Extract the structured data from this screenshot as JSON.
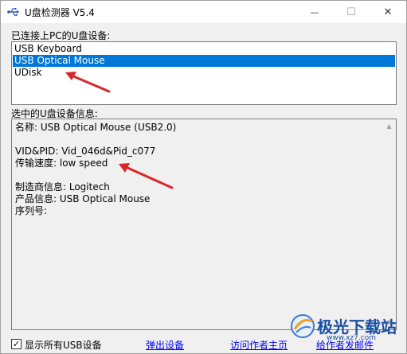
{
  "window": {
    "title": "U盘检测器 V5.4",
    "minimize_glyph": "—",
    "maximize_glyph": "☐",
    "close_glyph": "✕"
  },
  "devices": {
    "label": "已连接上PC的U盘设备:",
    "items": [
      {
        "label": "USB Keyboard",
        "selected": false
      },
      {
        "label": "USB Optical Mouse",
        "selected": true
      },
      {
        "label": "UDisk",
        "selected": false
      }
    ]
  },
  "info": {
    "label": "选中的U盘设备信息:",
    "name_line": "名称: USB Optical Mouse  (USB2.0)",
    "vidpid_line": "VID&PID: Vid_046d&Pid_c077",
    "speed_line": "传输速度: low speed",
    "vendor_line": "制造商信息: Logitech",
    "product_line": "产品信息: USB Optical Mouse",
    "serial_line": "序列号:"
  },
  "footer": {
    "show_all_checked": true,
    "show_all_label": "显示所有USB设备",
    "eject_link": "弹出设备",
    "visit_author_link": "访问作者主页",
    "email_author_link": "给作者发邮件"
  },
  "watermark": {
    "brand": "极光下载站",
    "url": "www.xz7.com"
  },
  "colors": {
    "selection": "#0078d7",
    "annotation_arrow": "#d9262b",
    "link": "#0000ff"
  }
}
